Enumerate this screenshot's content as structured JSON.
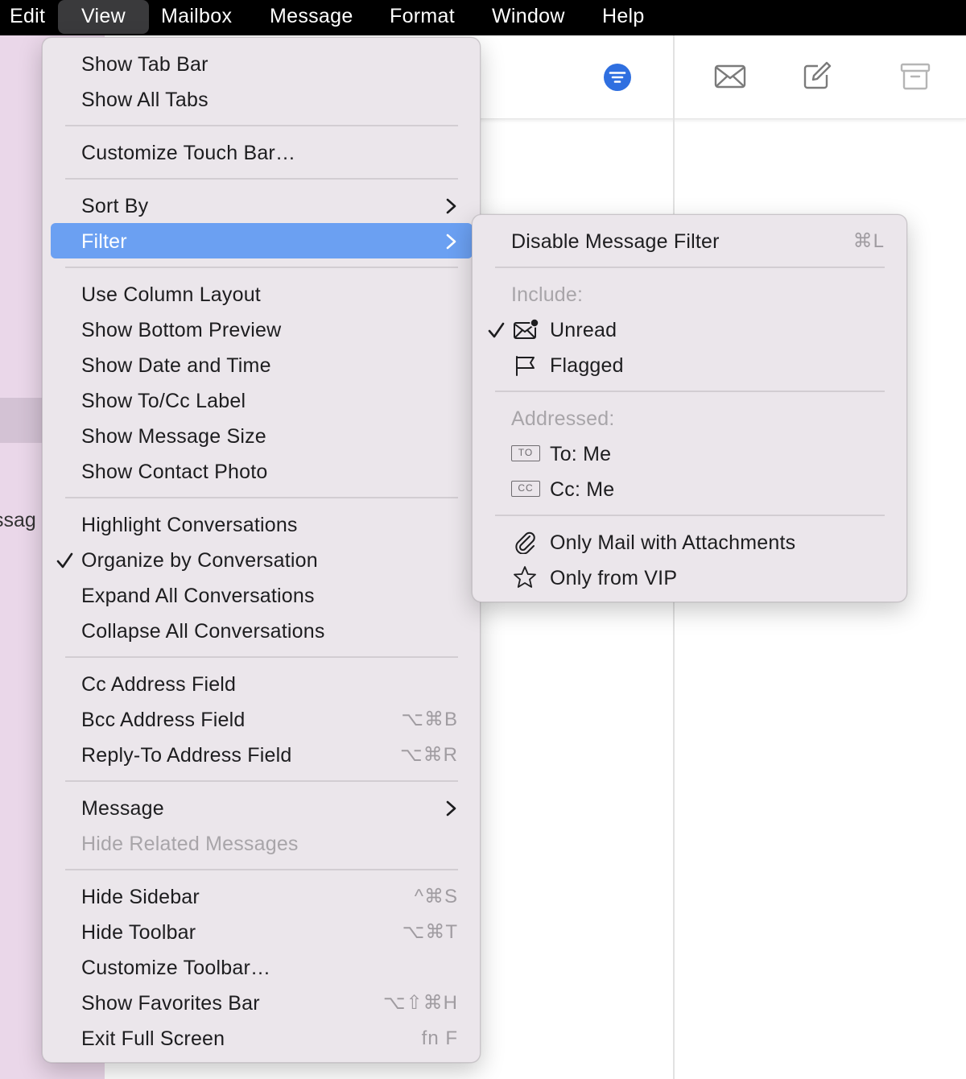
{
  "menubar": {
    "items": [
      "Edit",
      "View",
      "Mailbox",
      "Message",
      "Format",
      "Window",
      "Help"
    ]
  },
  "sidebar": {
    "partial_text": "ssag"
  },
  "toolbar": {
    "icons": [
      "filter-icon",
      "envelope-icon",
      "compose-icon",
      "archive-icon"
    ],
    "accent_color": "#2f6fe0"
  },
  "view_menu": {
    "items": [
      {
        "label": "Show Tab Bar"
      },
      {
        "label": "Show All Tabs"
      },
      {
        "label": "Customize Touch Bar…"
      },
      {
        "label": "Sort By"
      },
      {
        "label": "Filter"
      },
      {
        "label": "Use Column Layout"
      },
      {
        "label": "Show Bottom Preview"
      },
      {
        "label": "Show Date and Time"
      },
      {
        "label": "Show To/Cc Label"
      },
      {
        "label": "Show Message Size"
      },
      {
        "label": "Show Contact Photo"
      },
      {
        "label": "Highlight Conversations"
      },
      {
        "label": "Organize by Conversation"
      },
      {
        "label": "Expand All Conversations"
      },
      {
        "label": "Collapse All Conversations"
      },
      {
        "label": "Cc Address Field"
      },
      {
        "label": "Bcc Address Field",
        "shortcut": "⌥⌘B"
      },
      {
        "label": "Reply-To Address Field",
        "shortcut": "⌥⌘R"
      },
      {
        "label": "Message"
      },
      {
        "label": "Hide Related Messages"
      },
      {
        "label": "Hide Sidebar",
        "shortcut": "^⌘S"
      },
      {
        "label": "Hide Toolbar",
        "shortcut": "⌥⌘T"
      },
      {
        "label": "Customize Toolbar…"
      },
      {
        "label": "Show Favorites Bar",
        "shortcut": "⌥⇧⌘H"
      },
      {
        "label": "Exit Full Screen",
        "shortcut": "fn F"
      }
    ]
  },
  "filter_menu": {
    "disable": {
      "label": "Disable Message Filter",
      "shortcut": "⌘L"
    },
    "include_header": "Include:",
    "unread": "Unread",
    "flagged": "Flagged",
    "addressed_header": "Addressed:",
    "to_me": "To: Me",
    "to_badge": "TO",
    "cc_me": "Cc: Me",
    "cc_badge": "CC",
    "attachments": "Only Mail with Attachments",
    "vip": "Only from VIP"
  }
}
